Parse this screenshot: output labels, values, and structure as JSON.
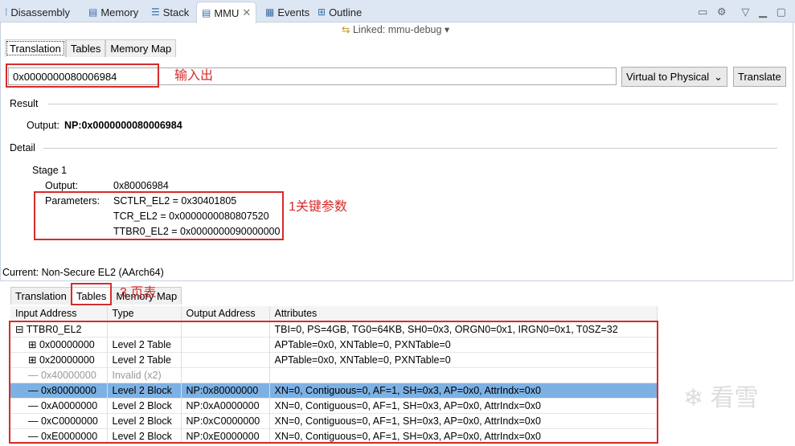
{
  "view_tabs": [
    {
      "label": "Disassembly",
      "icon": "disassembly-icon"
    },
    {
      "label": "Memory",
      "icon": "memory-icon"
    },
    {
      "label": "Stack",
      "icon": "stack-icon"
    },
    {
      "label": "MMU",
      "icon": "mmu-icon",
      "active": true
    },
    {
      "label": "Events",
      "icon": "events-icon"
    },
    {
      "label": "Outline",
      "icon": "outline-icon"
    }
  ],
  "linked": "Linked: mmu-debug",
  "top_tabs": [
    "Translation",
    "Tables",
    "Memory Map"
  ],
  "address_input": "0x0000000080006984",
  "mode_select": "Virtual to Physical",
  "translate_button": "Translate",
  "result_label": "Result",
  "output_label": "Output:",
  "output_value": "NP:0x0000000080006984",
  "detail_label": "Detail",
  "stage": "Stage 1",
  "stage_output_label": "Output:",
  "stage_output_value": "0x80006984",
  "parameters_label": "Parameters:",
  "parameters": [
    "SCTLR_EL2 = 0x30401805",
    "TCR_EL2 = 0x0000000080807520",
    "TTBR0_EL2 = 0x0000000090000000"
  ],
  "status": "Current: Non-Secure EL2 (AArch64)",
  "annotations": {
    "input_output": "输入出",
    "key_params": "1关键参数",
    "page_table": "3 页表"
  },
  "bottom_tabs": [
    "Translation",
    "Tables",
    "Memory Map"
  ],
  "table": {
    "columns": [
      "Input Address",
      "Type",
      "Output Address",
      "Attributes"
    ],
    "rows": [
      [
        "⊟ TTBR0_EL2",
        "",
        "",
        "TBI=0, PS=4GB, TG0=64KB, SH0=0x3, ORGN0=0x1, IRGN0=0x1, T0SZ=32"
      ],
      [
        "⊞ 0x00000000",
        "Level 2 Table",
        "",
        "APTable=0x0, XNTable=0, PXNTable=0"
      ],
      [
        "⊞ 0x20000000",
        "Level 2 Table",
        "",
        "APTable=0x0, XNTable=0, PXNTable=0"
      ],
      [
        "— 0x40000000",
        "Invalid (x2)",
        "",
        ""
      ],
      [
        "— 0x80000000",
        "Level 2 Block",
        "NP:0x80000000",
        "XN=0, Contiguous=0, AF=1, SH=0x3, AP=0x0, AttrIndx=0x0"
      ],
      [
        "— 0xA0000000",
        "Level 2 Block",
        "NP:0xA0000000",
        "XN=0, Contiguous=0, AF=1, SH=0x3, AP=0x0, AttrIndx=0x0"
      ],
      [
        "— 0xC0000000",
        "Level 2 Block",
        "NP:0xC0000000",
        "XN=0, Contiguous=0, AF=1, SH=0x3, AP=0x0, AttrIndx=0x0"
      ],
      [
        "— 0xE0000000",
        "Level 2 Block",
        "NP:0xE0000000",
        "XN=0, Contiguous=0, AF=1, SH=0x3, AP=0x0, AttrIndx=0x0"
      ]
    ]
  },
  "watermark": "看雪"
}
